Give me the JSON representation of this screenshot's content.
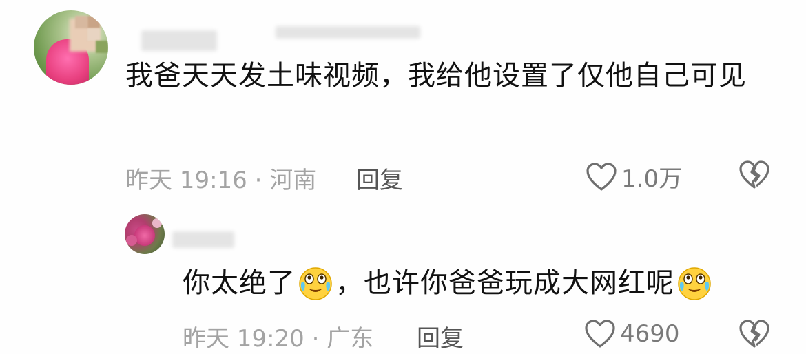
{
  "comments": [
    {
      "text": "我爸天天发土味视频，我给他设置了仅他自己可见",
      "time_location": "昨天 19:16 · 河南",
      "reply_label": "回复",
      "likes": "1.0万",
      "like_icon": "heart-outline-icon",
      "dislike_icon": "broken-heart-icon"
    },
    {
      "text_part1": "你太绝了",
      "text_part2": "，也许你爸爸玩成大网红呢",
      "emoji": "crying-laughing-face-icon",
      "time_location": "昨天 19:20 · 广东",
      "reply_label": "回复",
      "likes": "4690",
      "like_icon": "heart-outline-icon",
      "dislike_icon": "broken-heart-icon"
    }
  ],
  "colors": {
    "text": "#111111",
    "meta": "#a3a3a3",
    "reply": "#555555",
    "icon": "#6f6f6f"
  }
}
